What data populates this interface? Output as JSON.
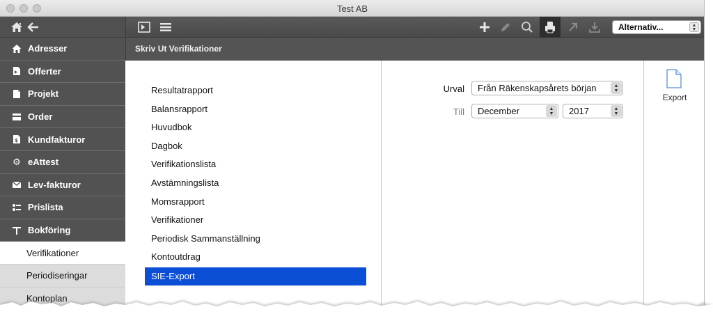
{
  "window": {
    "title": "Test AB"
  },
  "nav": {
    "home_icon": "home-icon",
    "back_icon": "back-arrow-icon",
    "items": [
      {
        "label": "Adresser",
        "icon": "house-icon"
      },
      {
        "label": "Offerter",
        "icon": "document-arrow-icon"
      },
      {
        "label": "Projekt",
        "icon": "page-icon"
      },
      {
        "label": "Order",
        "icon": "card-icon"
      },
      {
        "label": "Kundfakturor",
        "icon": "invoice-icon"
      },
      {
        "label": "eAttest",
        "icon": "gear-icon"
      },
      {
        "label": "Lev-fakturor",
        "icon": "envelope-icon"
      },
      {
        "label": "Prislista",
        "icon": "price-list-icon"
      },
      {
        "label": "Bokföring",
        "icon": "t-account-icon"
      }
    ],
    "subitems": [
      {
        "label": "Verifikationer",
        "active": true
      },
      {
        "label": "Periodiseringar",
        "active": false
      },
      {
        "label": "Kontoplan",
        "active": false
      }
    ]
  },
  "toolbar": {
    "left_icons": [
      "sidebar-toggle-icon",
      "list-icon"
    ],
    "right_icons": [
      "plus-icon",
      "pencil-icon",
      "search-icon",
      "print-icon",
      "export-arrow-icon",
      "download-icon"
    ],
    "options_label": "Alternativ..."
  },
  "section": {
    "title": "Skriv Ut Verifikationer"
  },
  "reports": {
    "items": [
      "Resultatrapport",
      "Balansrapport",
      "Huvudbok",
      "Dagbok",
      "Verifikationslista",
      "Avstämningslista",
      "Momsrapport",
      "Verifikationer",
      "Periodisk Sammanställning",
      "Kontoutdrag",
      "SIE-Export"
    ],
    "selected": "SIE-Export"
  },
  "form": {
    "urval_label": "Urval",
    "urval_value": "Från Räkenskapsårets början",
    "till_label": "Till",
    "till_month": "December",
    "till_year": "2017"
  },
  "export": {
    "label": "Export",
    "icon": "document-icon"
  },
  "colors": {
    "selection": "#0a4fd6",
    "sidebar": "#525252",
    "header": "#545454"
  }
}
